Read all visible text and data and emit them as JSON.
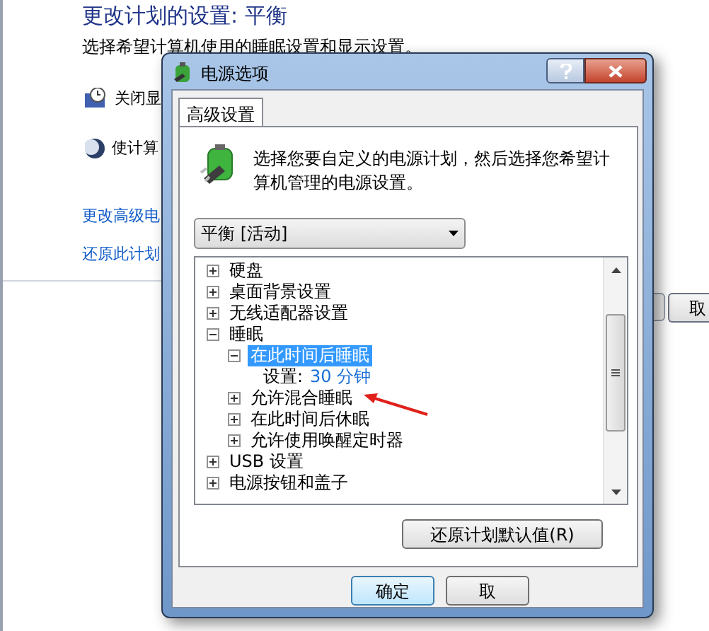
{
  "background_window": {
    "title": "更改计划的设置: 平衡",
    "subtitle": "选择希望计算机使用的睡眠设置和显示设置。",
    "settings": [
      {
        "kind": "display",
        "label": "关闭显"
      },
      {
        "kind": "sleep",
        "label": "使计算"
      }
    ],
    "links": [
      "更改高级电",
      "还原此计划"
    ],
    "button": "取"
  },
  "dialog": {
    "title": "电源选项",
    "tabs": [
      {
        "label": "高级设置",
        "selected": true
      }
    ],
    "description": "选择您要自定义的电源计划，然后选择您希望计算机管理的电源设置。",
    "plan_dropdown": "平衡 [活动]",
    "tree": [
      {
        "kind": "node",
        "label": "硬盘",
        "expanded": false,
        "selected": false
      },
      {
        "kind": "node",
        "label": "桌面背景设置",
        "expanded": false,
        "selected": false
      },
      {
        "kind": "node",
        "label": "无线适配器设置",
        "expanded": false,
        "selected": false
      },
      {
        "kind": "node",
        "label": "睡眠",
        "expanded": true,
        "selected": false,
        "children": [
          {
            "kind": "node",
            "label": "在此时间后睡眠",
            "expanded": true,
            "selected": true,
            "children": [
              {
                "kind": "setting",
                "label": "设置:",
                "value": "30 分钟"
              }
            ]
          },
          {
            "kind": "node",
            "label": "允许混合睡眠",
            "expanded": false,
            "selected": false
          },
          {
            "kind": "node",
            "label": "在此时间后休眠",
            "expanded": false,
            "selected": false
          },
          {
            "kind": "node",
            "label": "允许使用唤醒定时器",
            "expanded": false,
            "selected": false
          }
        ]
      },
      {
        "kind": "node",
        "label": "USB 设置",
        "expanded": false,
        "selected": false
      },
      {
        "kind": "node",
        "label": "电源按钮和盖子",
        "expanded": false,
        "selected": false
      }
    ],
    "restore_button": "还原计划默认值(R)",
    "buttons": [
      "确定",
      "取"
    ]
  }
}
